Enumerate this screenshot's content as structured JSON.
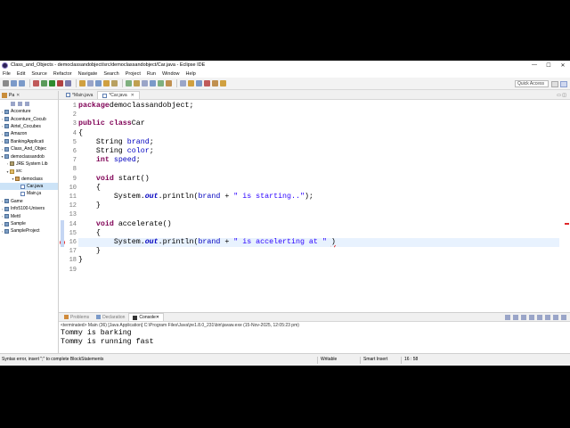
{
  "window": {
    "title": "Class_and_Objects - democlassandobject/src/democlassandobject/Car.java - Eclipse IDE",
    "controls": {
      "minimize": "—",
      "maximize": "☐",
      "close": "✕"
    }
  },
  "menu": [
    "File",
    "Edit",
    "Source",
    "Refactor",
    "Navigate",
    "Search",
    "Project",
    "Run",
    "Window",
    "Help"
  ],
  "toolbar": {
    "quick_access_placeholder": "Quick Access",
    "icon_colors": [
      "#8a8a8a",
      "#7b9ac9",
      "#7b9ac9",
      "#c05a5a",
      "#5a9a5a",
      "#2e8b2e",
      "#b14141",
      "#7a7aaa",
      "#d0a040",
      "#9aa5c8",
      "#7b9ac9",
      "#d0a040",
      "#b8a060",
      "#7fb07f",
      "#c0a050",
      "#9aa5c8",
      "#7b9ac9",
      "#7fb07f",
      "#c09050",
      "#9aa5c8",
      "#d0a040",
      "#7b9ac9",
      "#c05a5a",
      "#c09050",
      "#d0a040"
    ]
  },
  "package_explorer": {
    "tab_label": "Pa",
    "items": [
      {
        "label": "Accenture",
        "level": 0,
        "icon": "project-icon",
        "expanded": false
      },
      {
        "label": "Accenture_Cocub",
        "level": 0,
        "icon": "project-icon",
        "expanded": false
      },
      {
        "label": "Airtel_Cocubes",
        "level": 0,
        "icon": "project-icon",
        "expanded": false
      },
      {
        "label": "Amazon",
        "level": 0,
        "icon": "project-icon",
        "expanded": false
      },
      {
        "label": "BankingApplicati",
        "level": 0,
        "icon": "project-icon",
        "expanded": false
      },
      {
        "label": "Class_And_Objec",
        "level": 0,
        "icon": "project-icon",
        "expanded": false
      },
      {
        "label": "democlassandob",
        "level": 0,
        "icon": "project-icon",
        "expanded": true
      },
      {
        "label": "JRE System Lib",
        "level": 1,
        "icon": "library-icon",
        "expanded": false
      },
      {
        "label": "src",
        "level": 1,
        "icon": "folder-icon",
        "expanded": true
      },
      {
        "label": "democlass",
        "level": 2,
        "icon": "package-icon",
        "expanded": true
      },
      {
        "label": "Car.java",
        "level": 3,
        "icon": "java-file-icon",
        "expanded": false,
        "selected": true
      },
      {
        "label": "Main.ja",
        "level": 3,
        "icon": "java-file-icon",
        "expanded": false
      },
      {
        "label": "Game",
        "level": 0,
        "icon": "project-icon",
        "expanded": false
      },
      {
        "label": "Info5100-Univers",
        "level": 0,
        "icon": "project-icon",
        "expanded": false
      },
      {
        "label": "Mettl",
        "level": 0,
        "icon": "project-icon",
        "expanded": false
      },
      {
        "label": "Sample",
        "level": 0,
        "icon": "project-icon",
        "expanded": false
      },
      {
        "label": "SampleProject",
        "level": 0,
        "icon": "project-icon",
        "expanded": false
      }
    ]
  },
  "editor": {
    "tabs": [
      {
        "label": "*Main.java",
        "active": false
      },
      {
        "label": "*Car.java",
        "active": true
      }
    ],
    "current_line": 16,
    "lines": [
      {
        "n": "1",
        "tokens": [
          [
            "kw",
            "package"
          ],
          [
            "",
            "democlassandobject;"
          ]
        ]
      },
      {
        "n": "2",
        "tokens": []
      },
      {
        "n": "3",
        "tokens": [
          [
            "kw",
            "public"
          ],
          [
            "",
            ""
          ],
          [
            "kw",
            "class"
          ],
          [
            "",
            "Car"
          ]
        ]
      },
      {
        "n": "4",
        "tokens": [
          [
            "",
            "{"
          ]
        ]
      },
      {
        "n": "5",
        "tokens": [
          [
            "",
            "    String "
          ],
          [
            "fld",
            "brand"
          ],
          [
            "",
            ";"
          ]
        ]
      },
      {
        "n": "6",
        "tokens": [
          [
            "",
            "    String "
          ],
          [
            "fld",
            "color"
          ],
          [
            "",
            ";"
          ]
        ]
      },
      {
        "n": "7",
        "tokens": [
          [
            "",
            "    "
          ],
          [
            "kw",
            "int"
          ],
          [
            "",
            ""
          ],
          [
            "fld",
            "speed"
          ],
          [
            "",
            ";"
          ]
        ]
      },
      {
        "n": "8",
        "tokens": []
      },
      {
        "n": "9",
        "tokens": [
          [
            "",
            "    "
          ],
          [
            "kw",
            "void"
          ],
          [
            "",
            " start()"
          ]
        ]
      },
      {
        "n": "10",
        "tokens": [
          [
            "",
            "    {"
          ]
        ]
      },
      {
        "n": "11",
        "tokens": [
          [
            "",
            "        System."
          ],
          [
            "fldi",
            "out"
          ],
          [
            "",
            ".println("
          ],
          [
            "fld",
            "brand"
          ],
          [
            "",
            " + "
          ],
          [
            "str",
            "\" is starting..\""
          ],
          [
            "",
            ");"
          ]
        ]
      },
      {
        "n": "12",
        "tokens": [
          [
            "",
            "    }"
          ]
        ]
      },
      {
        "n": "13",
        "tokens": []
      },
      {
        "n": "14",
        "tokens": [
          [
            "",
            "    "
          ],
          [
            "kw",
            "void"
          ],
          [
            "",
            " accelerate()"
          ]
        ]
      },
      {
        "n": "15",
        "tokens": [
          [
            "",
            "    {"
          ]
        ]
      },
      {
        "n": "16",
        "error": true,
        "tokens": [
          [
            "",
            "        System."
          ],
          [
            "fldi",
            "out"
          ],
          [
            "",
            ".println("
          ],
          [
            "fld",
            "brand"
          ],
          [
            "",
            " + "
          ],
          [
            "str",
            "\" is accelerting at \""
          ],
          [
            "",
            " "
          ],
          [
            "err",
            ")"
          ]
        ]
      },
      {
        "n": "17",
        "tokens": [
          [
            "",
            "    }"
          ]
        ]
      },
      {
        "n": "18",
        "tokens": [
          [
            "",
            "}"
          ]
        ]
      },
      {
        "n": "19",
        "tokens": []
      }
    ]
  },
  "console": {
    "tabs": [
      {
        "label": "Problems",
        "active": false
      },
      {
        "label": "Declaration",
        "active": false
      },
      {
        "label": "Console",
        "active": true
      }
    ],
    "terminated_label": "<terminated> Main (36) [Java Application] C:\\Program Files\\Java\\jre1.8.0_231\\bin\\javaw.exe (15-Nov-2025, 12:05:23 pm)",
    "output": [
      "Tommy is barking",
      "Tommy is running fast"
    ]
  },
  "status": {
    "message": "Syntax error, insert \";\" to complete BlockStatements",
    "writable": "Writable",
    "insert_mode": "Smart Insert",
    "position": "16 : 58"
  }
}
